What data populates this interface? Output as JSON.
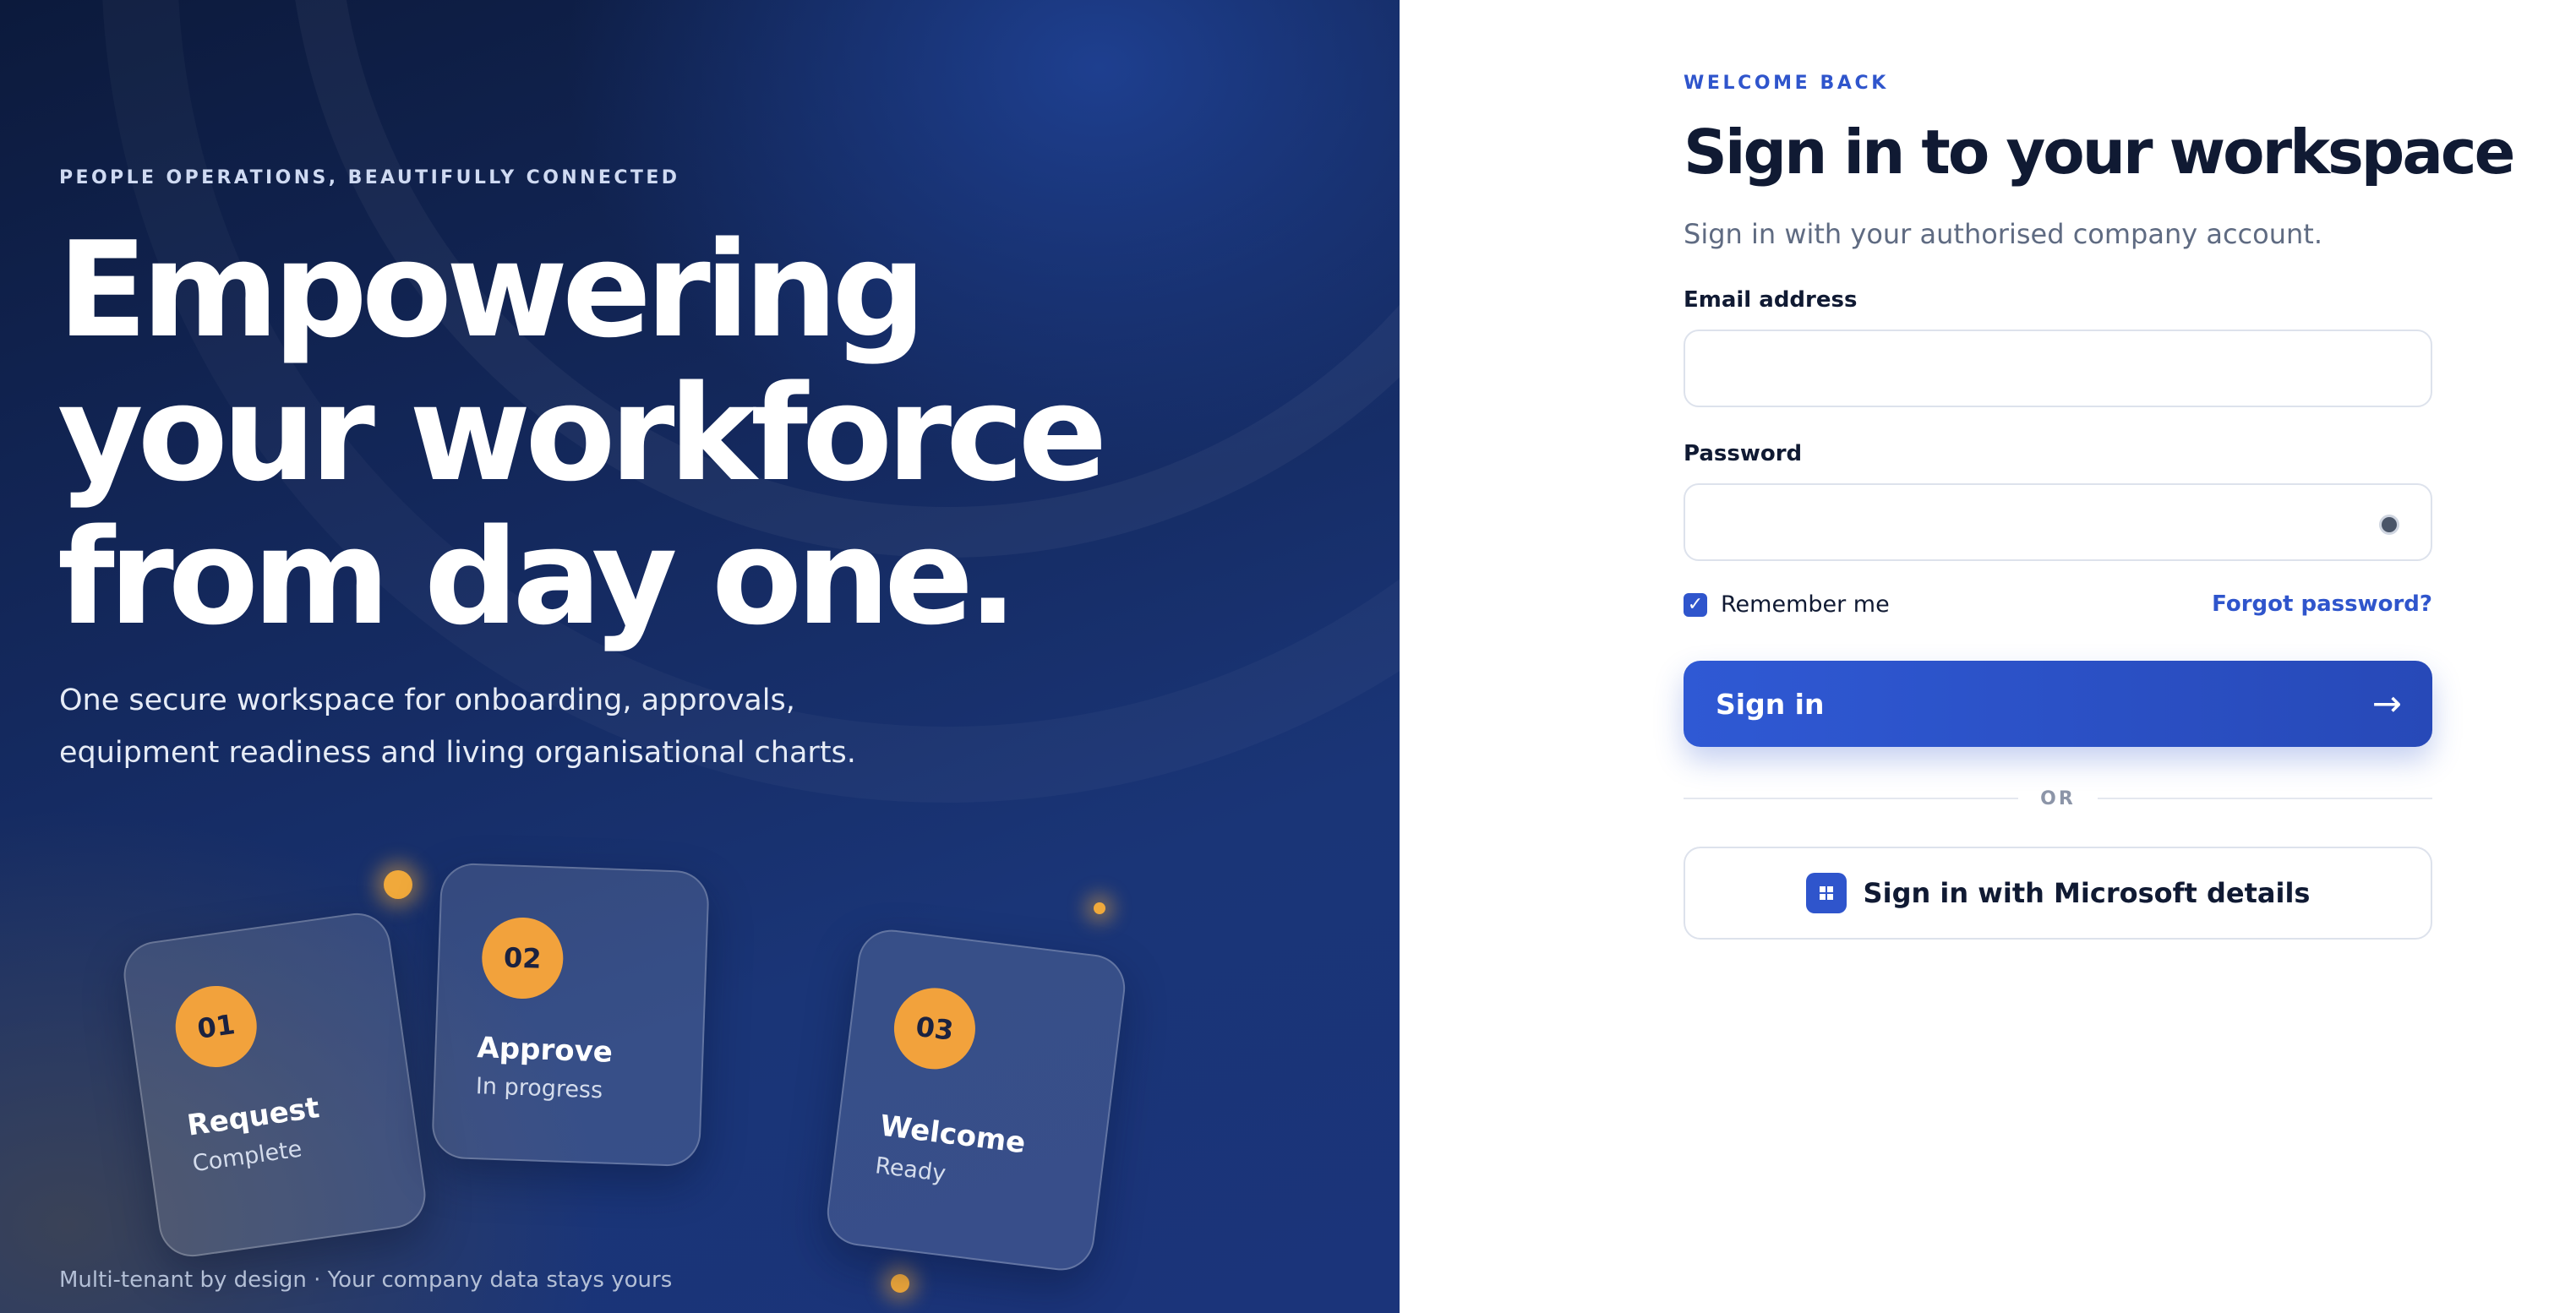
{
  "hero": {
    "eyebrow": "PEOPLE OPERATIONS, BEAUTIFULLY CONNECTED",
    "headline": [
      "Empowering",
      "your workforce",
      "from day one."
    ],
    "subcopy_lines": [
      "One secure workspace for onboarding, approvals,",
      "equipment readiness and living organisational charts."
    ],
    "steps": [
      {
        "number": "01",
        "title": "Request",
        "status": "Complete"
      },
      {
        "number": "02",
        "title": "Approve",
        "status": "In progress"
      },
      {
        "number": "03",
        "title": "Welcome",
        "status": "Ready"
      }
    ],
    "footnote": "Multi-tenant by design · Your company data stays yours"
  },
  "form": {
    "eyebrow": "WELCOME BACK",
    "title": "Sign in to your workspace",
    "subtitle": "Sign in with your authorised company account.",
    "email_label": "Email address",
    "email_value": "",
    "password_label": "Password",
    "password_value": "",
    "remember_label": "Remember me",
    "remember_checked": true,
    "forgot_label": "Forgot password?",
    "signin_label": "Sign in",
    "signin_arrow": "→",
    "divider_label": "OR",
    "microsoft_label": "Sign in with Microsoft details"
  },
  "colors": {
    "accent": "#2f55cc",
    "step_badge": "#f2a23c",
    "hero_dark": "#0c1a3c",
    "text_dark": "#101a33"
  },
  "icons": [
    "eye-icon",
    "check-icon",
    "arrow-right-icon",
    "microsoft-icon"
  ]
}
